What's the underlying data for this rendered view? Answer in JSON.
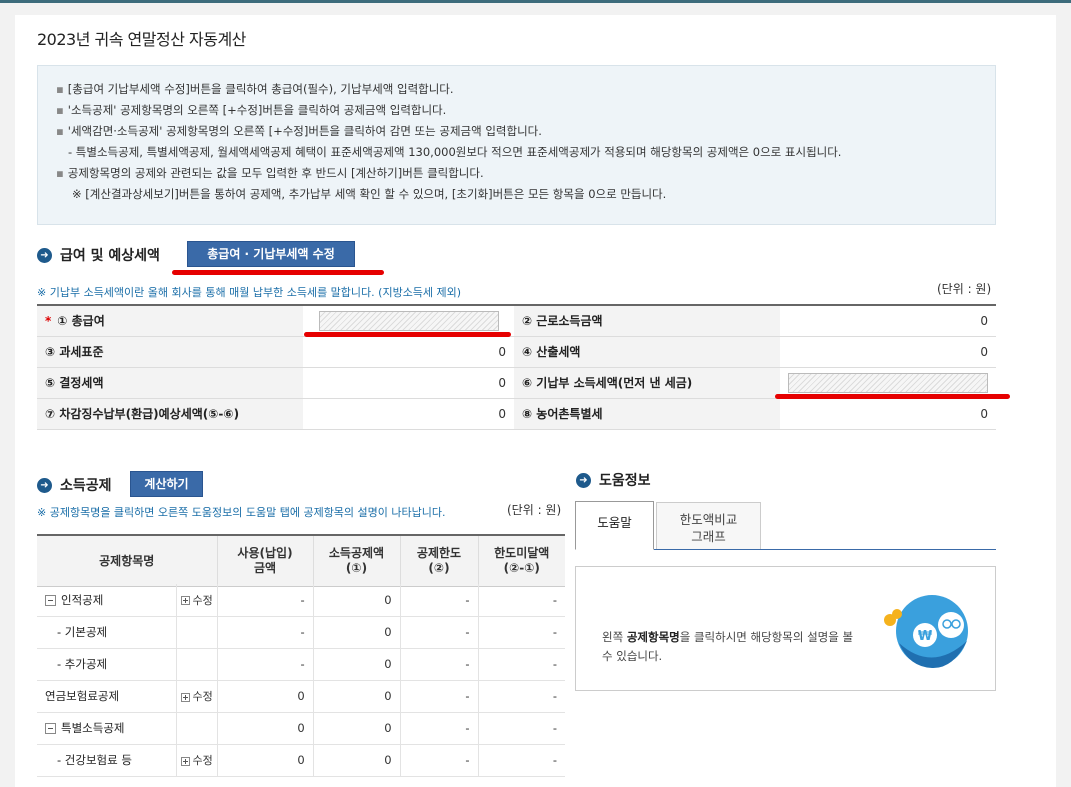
{
  "page": {
    "title": "2023년 귀속 연말정산 자동계산"
  },
  "info": {
    "line1": "[총급여 기납부세액 수정]버튼을 클릭하여 총급여(필수), 기납부세액 입력합니다.",
    "line2": "'소득공제' 공제항목명의 오른쪽 [+수정]버튼을 클릭하여 공제금액 입력합니다.",
    "line3": "'세액감면·소득공제' 공제항목명의 오른쪽 [+수정]버튼을 클릭하여 감면 또는 공제금액 입력합니다.",
    "line3sub": "- 특별소득공제, 특별세액공제, 월세액세액공제 혜택이 표준세액공제액 130,000원보다 적으면 표준세액공제가 적용되며 해당항목의 공제액은 0으로 표시됩니다.",
    "line4": "공제항목명의 공제와 관련되는 값을 모두 입력한 후 반드시 [계산하기]버튼 클릭합니다.",
    "line4sub": "※ [계산결과상세보기]버튼을 통하여 공제액, 추가납부 세액 확인 할 수 있으며, [초기화]버튼은 모든 항목을 0으로 만듭니다."
  },
  "salary": {
    "section_title": "급여 및 예상세액",
    "edit_button": "총급여 · 기납부세액 수정",
    "note": "※ 기납부 소득세액이란 올해 회사를 통해 매월 납부한 소득세를 말합니다. (지방소득세 제외)",
    "unit": "(단위 : 원)",
    "rows": [
      {
        "l_label": "① 총급여",
        "l_value": "",
        "r_label": "② 근로소득금액",
        "r_value": "0"
      },
      {
        "l_label": "③ 과세표준",
        "l_value": "0",
        "r_label": "④ 산출세액",
        "r_value": "0"
      },
      {
        "l_label": "⑤ 결정세액",
        "l_value": "0",
        "r_label": "⑥ 기납부 소득세액(먼저 낸 세금)",
        "r_value": ""
      },
      {
        "l_label": "⑦ 차감징수납부(환급)예상세액(⑤-⑥)",
        "l_value": "0",
        "r_label": "⑧ 농어촌특별세",
        "r_value": "0"
      }
    ],
    "required_mark": "*"
  },
  "deduction": {
    "section_title": "소득공제",
    "calc_button": "계산하기",
    "note": "※ 공제항목명을 클릭하면 오른쪽 도움정보의 도움말 탭에 공제항목의 설명이 나타납니다.",
    "unit": "(단위 : 원)",
    "headers": {
      "name": "공제항목명",
      "used1": "사용(납입)",
      "used2": "금액",
      "amt1": "소득공제액",
      "amt2": "(①)",
      "limit1": "공제한도",
      "limit2": "(②)",
      "short1": "한도미달액",
      "short2": "(②-①)"
    },
    "rows": [
      {
        "name": "인적공제",
        "action": "수정",
        "used": "-",
        "amount": "0",
        "limit": "-",
        "short": "-"
      },
      {
        "name": "- 기본공제",
        "action": "",
        "used": "-",
        "amount": "0",
        "limit": "-",
        "short": "-"
      },
      {
        "name": "- 추가공제",
        "action": "",
        "used": "-",
        "amount": "0",
        "limit": "-",
        "short": "-"
      },
      {
        "name": "연금보험료공제",
        "action": "수정",
        "used": "0",
        "amount": "0",
        "limit": "-",
        "short": "-"
      },
      {
        "name": "특별소득공제",
        "action": "",
        "used": "0",
        "amount": "0",
        "limit": "-",
        "short": "-"
      },
      {
        "name": "- 건강보험료 등",
        "action": "수정",
        "used": "0",
        "amount": "0",
        "limit": "-",
        "short": "-"
      }
    ]
  },
  "help": {
    "section_title": "도움정보",
    "tab_help": "도움말",
    "tab_graph1": "한도액비교",
    "tab_graph2": "그래프",
    "msg_pre": "왼쪽 ",
    "msg_bold": "공제항목명",
    "msg_post": "을 클릭하시면 해당항목의 설명을 볼 수 있습니다."
  },
  "colors": {
    "accent": "#3a6aa8",
    "highlight": "#e60000",
    "note": "#1a6ea8"
  }
}
